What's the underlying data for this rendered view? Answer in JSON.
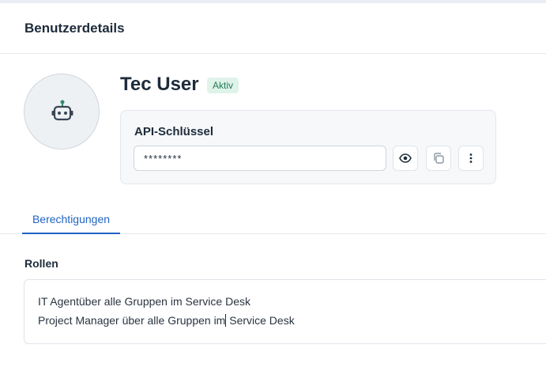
{
  "header": {
    "title": "Benutzerdetails"
  },
  "user": {
    "name": "Tec User",
    "status": "Aktiv",
    "avatar_icon": "robot-icon"
  },
  "api_key": {
    "title": "API-Schlüssel",
    "value": "********",
    "actions": [
      {
        "icon": "eye-icon"
      },
      {
        "icon": "copy-icon"
      },
      {
        "icon": "more-vertical-icon"
      }
    ]
  },
  "tabs": [
    {
      "label": "Berechtigungen",
      "active": true
    }
  ],
  "roles": {
    "label": "Rollen",
    "line1": "IT Agentüber alle Gruppen im Service Desk",
    "line2_part1": "Project Manager über alle Gruppen im",
    "line2_part2": " Service Desk"
  },
  "colors": {
    "accent": "#2164c6",
    "badge_bg": "#dff3ea",
    "badge_text": "#217a55",
    "robot_accent": "#2e8a68"
  }
}
